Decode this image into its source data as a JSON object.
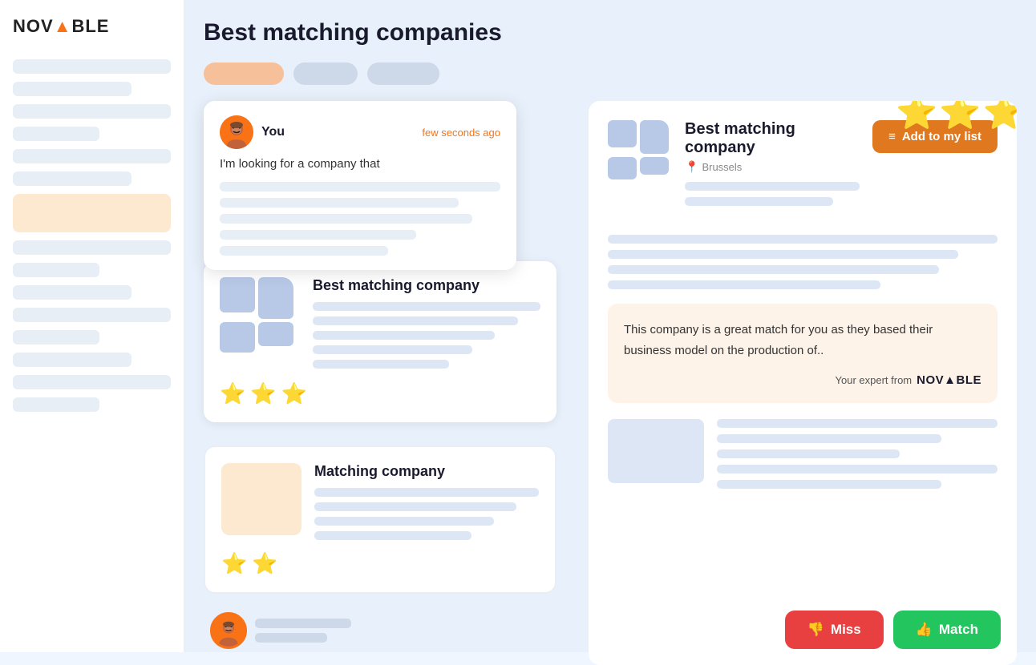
{
  "app": {
    "logo": "NOVABLE",
    "logo_highlight": "3"
  },
  "page": {
    "title": "Best matching companies"
  },
  "filters": [
    {
      "label": "",
      "color": "orange"
    },
    {
      "label": "",
      "color": "gray"
    },
    {
      "label": "",
      "color": "gray"
    }
  ],
  "chat": {
    "user_name": "You",
    "time_label": "few seconds ago",
    "message": "I'm looking for a company that"
  },
  "left_card": {
    "title": "Best matching company",
    "stars": [
      "⭐",
      "⭐",
      "⭐"
    ]
  },
  "matching_card": {
    "title": "Matching company",
    "stars": [
      "⭐",
      "⭐"
    ]
  },
  "right_panel": {
    "company_title": "Best matching company",
    "location": "Brussels",
    "add_to_list_label": "Add to my list",
    "match_description": "This company is a great match for you as they based their business model on the production of..",
    "expert_prefix": "Your expert from",
    "expert_brand": "NOVABLE",
    "stars": [
      "⭐",
      "⭐",
      "⭐"
    ]
  },
  "buttons": {
    "miss_label": "Miss",
    "match_label": "Match"
  }
}
